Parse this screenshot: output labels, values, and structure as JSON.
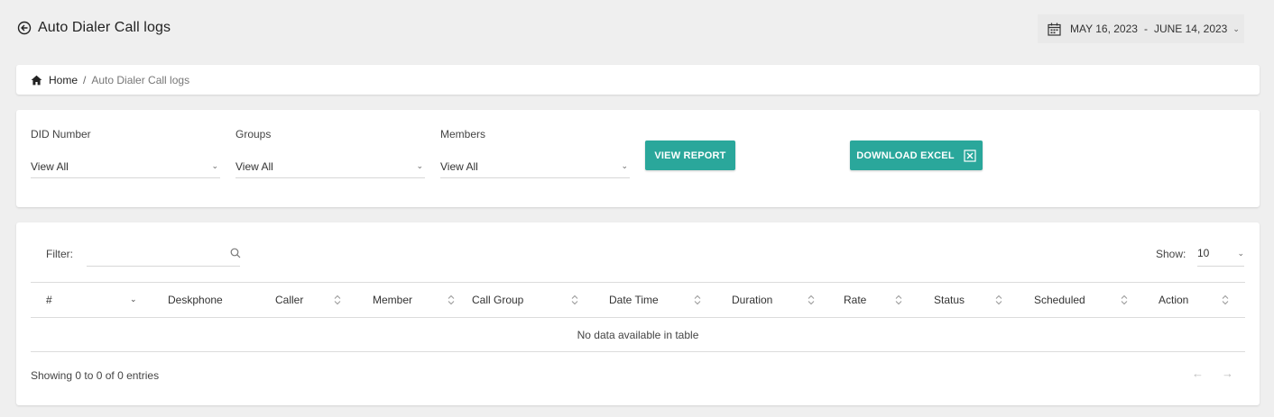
{
  "header": {
    "title": "Auto Dialer Call logs",
    "date_start": "MAY 16, 2023",
    "date_sep": "-",
    "date_end": "JUNE 14, 2023"
  },
  "breadcrumb": {
    "home": "Home",
    "separator": "/",
    "current": "Auto Dialer Call logs"
  },
  "filters": {
    "did": {
      "label": "DID Number",
      "value": "View All"
    },
    "groups": {
      "label": "Groups",
      "value": "View All"
    },
    "members": {
      "label": "Members",
      "value": "View All"
    },
    "view_report": "VIEW REPORT",
    "download_excel": "DOWNLOAD EXCEL"
  },
  "table": {
    "filter_label": "Filter:",
    "filter_value": "",
    "show_label": "Show:",
    "show_value": "10",
    "columns": [
      "#",
      "Deskphone",
      "Caller",
      "Member",
      "Call Group",
      "Date Time",
      "Duration",
      "Rate",
      "Status",
      "Scheduled",
      "Action"
    ],
    "empty_message": "No data available in table",
    "info": "Showing 0 to 0 of 0 entries",
    "prev": "←",
    "next": "→"
  },
  "colors": {
    "accent": "#2aa79b",
    "background": "#efefef"
  },
  "icons": [
    "back-arrow-icon",
    "calendar-icon",
    "home-icon",
    "excel-icon",
    "search-icon",
    "sort-icon",
    "chevron-down-icon"
  ]
}
